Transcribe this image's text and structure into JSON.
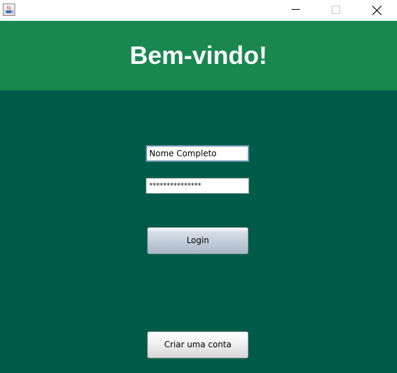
{
  "window": {
    "icons": {
      "app": "java-coffee-icon",
      "minimize": "minimize-icon",
      "maximize": "maximize-icon",
      "close": "close-icon"
    }
  },
  "header": {
    "title": "Bem-vindo!",
    "background": "#1a8751"
  },
  "form": {
    "background": "#005c49",
    "name_value": "Nome Completo",
    "password_value": "***************",
    "login_label": "Login",
    "create_account_label": "Criar uma conta"
  }
}
